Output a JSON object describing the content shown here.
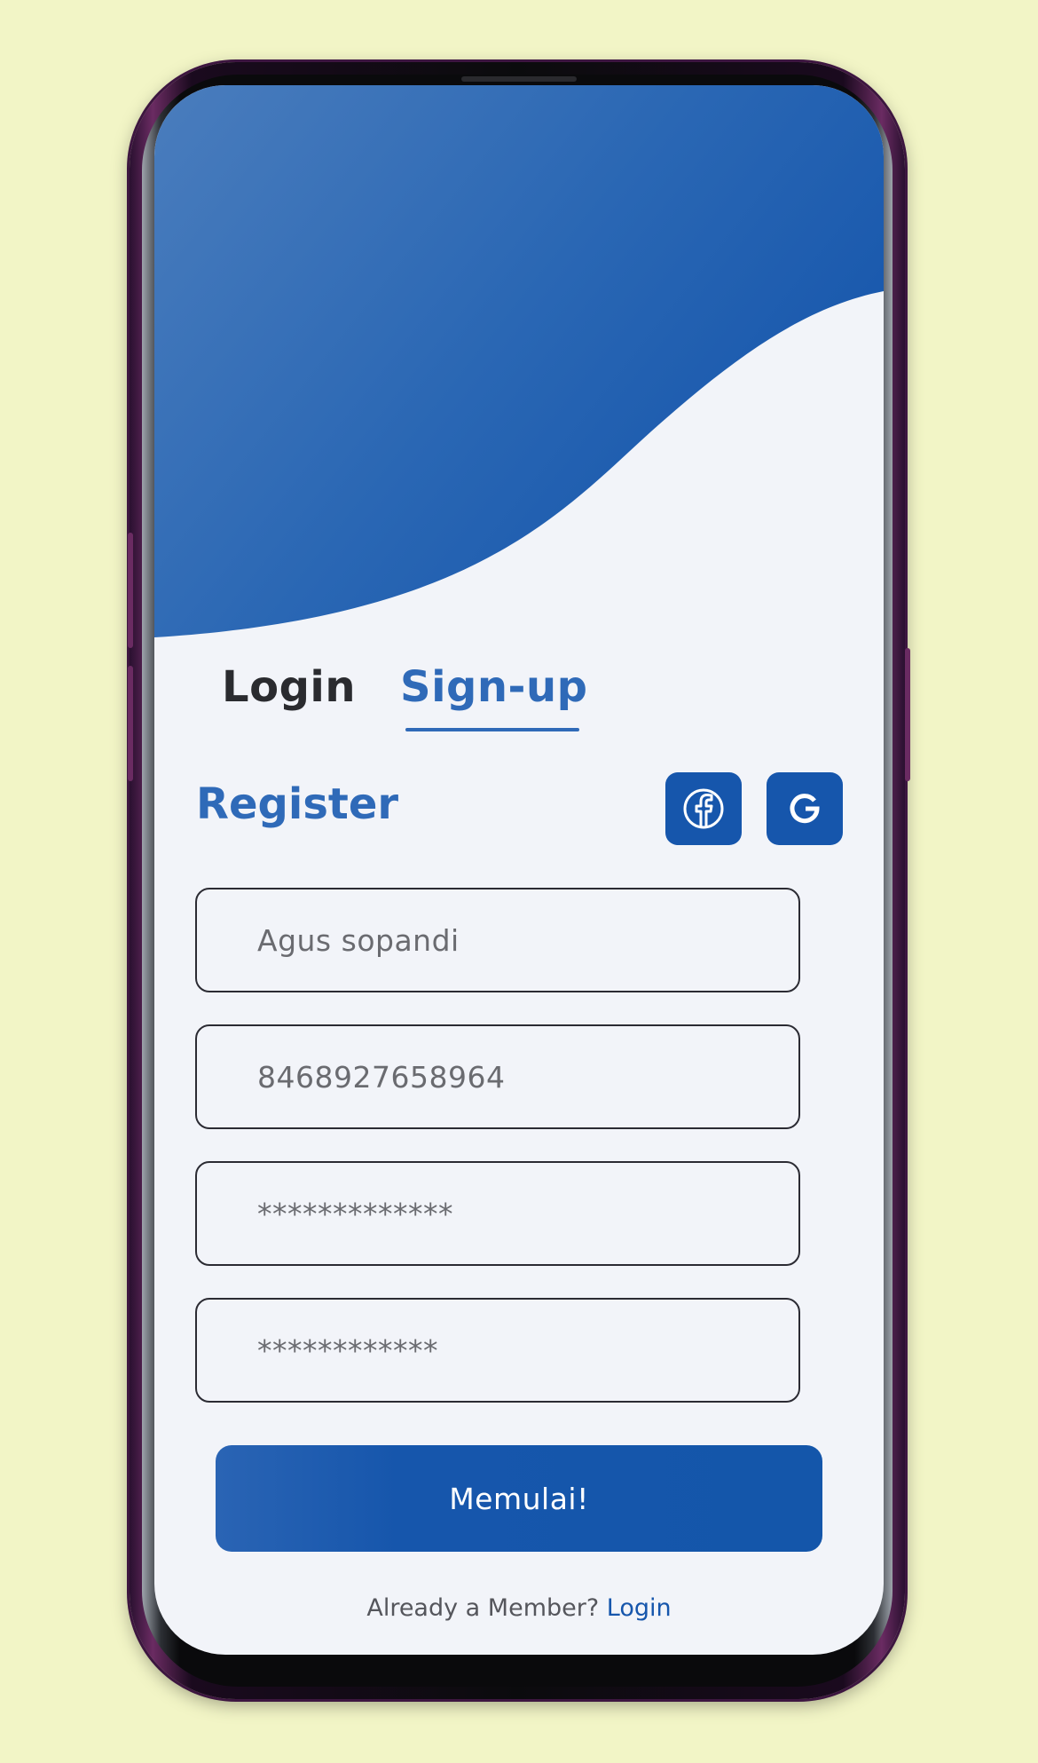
{
  "tabs": [
    {
      "label": "Login",
      "active": false
    },
    {
      "label": "Sign-up",
      "active": true
    }
  ],
  "register": {
    "title": "Register"
  },
  "social": [
    {
      "icon": "facebook-icon"
    },
    {
      "icon": "google-icon"
    }
  ],
  "fields": [
    {
      "value": "Agus sopandi"
    },
    {
      "value": "8468927658964"
    },
    {
      "value": "*************"
    },
    {
      "value": "************"
    }
  ],
  "cta": {
    "label": "Memulai!"
  },
  "footer": {
    "text": "Already a Member?",
    "link": "Login"
  },
  "colors": {
    "accent": "#2f6ab8",
    "primary": "#1656ac",
    "background": "#f2f5c6",
    "screen": "#f2f4f9",
    "text_dark": "#2a2b2f"
  }
}
